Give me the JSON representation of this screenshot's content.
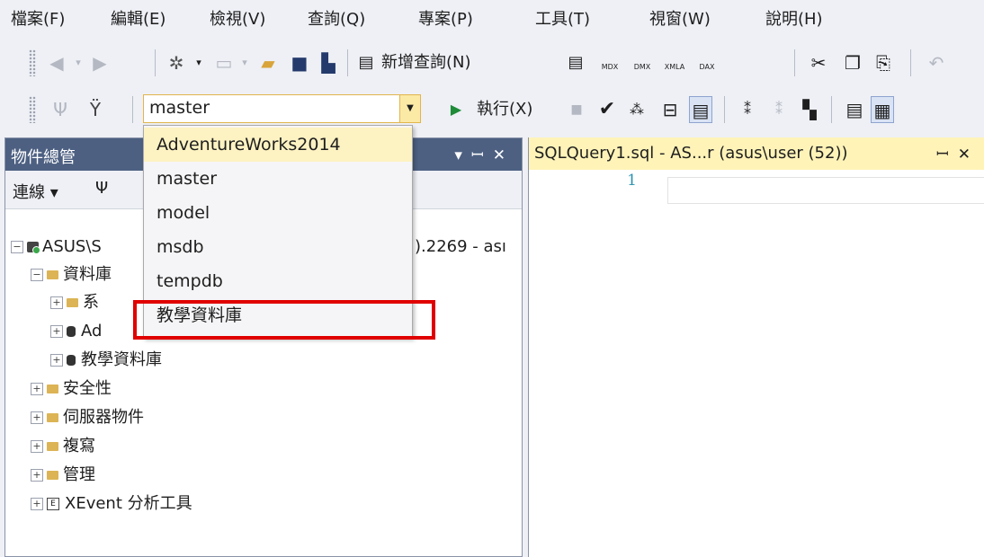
{
  "menu": [
    "檔案(F)",
    "編輯(E)",
    "檢視(V)",
    "查詢(Q)",
    "專案(P)",
    "工具(T)",
    "視窗(W)",
    "說明(H)"
  ],
  "toolbar1": {
    "new_query_label": "新增查詢(N)",
    "badges": [
      "MDX",
      "DMX",
      "XMLA",
      "DAX"
    ]
  },
  "toolbar2": {
    "database_value": "master",
    "execute_label": "執行(X)"
  },
  "object_explorer": {
    "title": "物件總管",
    "connect_label": "連線",
    "tree": [
      "ASUS\\S",
      ").2269 - ası",
      "資料庫",
      "系",
      "Ad",
      "教學資料庫",
      "安全性",
      "伺服器物件",
      "複寫",
      "管理",
      "XEvent 分析工具"
    ]
  },
  "query_tab": {
    "title": "SQLQuery1.sql - AS...r (asus\\user (52))",
    "line_number": "1"
  },
  "db_dropdown": {
    "options": [
      "AdventureWorks2014",
      "master",
      "model",
      "msdb",
      "tempdb",
      "教學資料庫"
    ],
    "selected_index": 0
  },
  "colors": {
    "title_bar": "#4d6082",
    "tab_active": "#fff3b8",
    "highlight": "#e00000",
    "accent": "#e1b54b"
  }
}
